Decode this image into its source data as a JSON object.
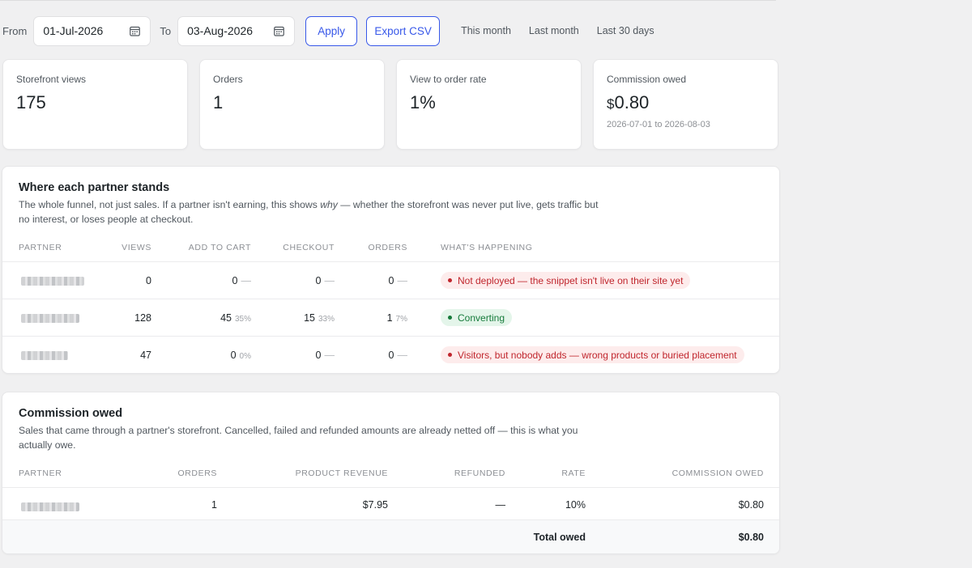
{
  "filters": {
    "from_label": "From",
    "from_value": "01-Jul-2026",
    "to_label": "To",
    "to_value": "03-Aug-2026",
    "apply_label": "Apply",
    "export_label": "Export CSV",
    "quick_ranges": [
      "This month",
      "Last month",
      "Last 30 days"
    ]
  },
  "stats": [
    {
      "label": "Storefront views",
      "value": "175"
    },
    {
      "label": "Orders",
      "value": "1"
    },
    {
      "label": "View to order rate",
      "value": "1%"
    },
    {
      "label": "Commission owed",
      "currency": "$",
      "value": "0.80",
      "sub": "2026-07-01 to 2026-08-03"
    }
  ],
  "funnel": {
    "title": "Where each partner stands",
    "desc_before": "The whole funnel, not just sales. If a partner isn't earning, this shows ",
    "desc_em": "why",
    "desc_after": " — whether the storefront was never put live, gets traffic but no interest, or loses people at checkout.",
    "headers": {
      "partner": "Partner",
      "views": "Views",
      "add_to_cart": "Add to cart",
      "checkout": "Checkout",
      "orders": "Orders",
      "status": "What's happening"
    },
    "rows": [
      {
        "views": "0",
        "cart": "0",
        "cart_pct": "—",
        "checkout": "0",
        "checkout_pct": "—",
        "orders": "0",
        "orders_pct": "—",
        "status": "Not deployed — the snippet isn't live on their site yet",
        "status_kind": "red"
      },
      {
        "views": "128",
        "cart": "45",
        "cart_pct": "35%",
        "checkout": "15",
        "checkout_pct": "33%",
        "orders": "1",
        "orders_pct": "7%",
        "status": "Converting",
        "status_kind": "green"
      },
      {
        "views": "47",
        "cart": "0",
        "cart_pct": "0%",
        "checkout": "0",
        "checkout_pct": "—",
        "orders": "0",
        "orders_pct": "—",
        "status": "Visitors, but nobody adds — wrong products or buried placement",
        "status_kind": "red"
      }
    ]
  },
  "commission": {
    "title": "Commission owed",
    "desc": "Sales that came through a partner's storefront. Cancelled, failed and refunded amounts are already netted off — this is what you actually owe.",
    "headers": {
      "partner": "Partner",
      "orders": "Orders",
      "revenue": "Product revenue",
      "refunded": "Refunded",
      "rate": "Rate",
      "owed": "Commission owed"
    },
    "rows": [
      {
        "orders": "1",
        "revenue": "$7.95",
        "refunded": "—",
        "rate": "10%",
        "owed": "$0.80"
      }
    ],
    "total_label": "Total owed",
    "total_value": "$0.80"
  }
}
